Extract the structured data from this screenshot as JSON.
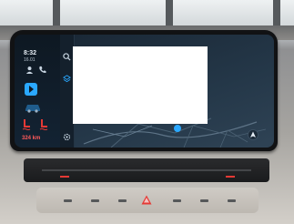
{
  "status": {
    "time": "8:32",
    "date": "16.01",
    "range": "324 km"
  },
  "colors": {
    "accent": "#2aa8ff",
    "warning": "#e53935",
    "screen_bg": "#101a24",
    "popup_bg": "#ffffff"
  },
  "icons": {
    "sidebar": [
      "profile-icon",
      "phone-icon",
      "media-icon",
      "car-icon",
      "seat-heat-icon"
    ],
    "nav_strip": [
      "search-icon",
      "layers-icon",
      "navigation-arrow-icon",
      "settings-icon"
    ],
    "console": [
      "hazard-icon"
    ]
  }
}
